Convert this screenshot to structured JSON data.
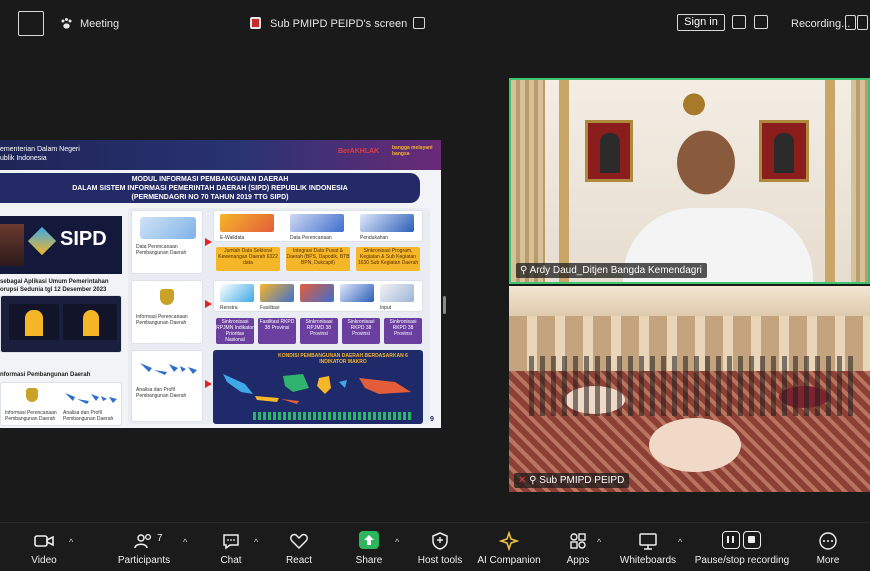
{
  "topbar": {
    "meeting_label": "Meeting",
    "screen_label": "Sub PMIPD PEIPD's screen",
    "signin_label": "Sign in",
    "recording_label": "Recording..."
  },
  "slide": {
    "org_line1": "ementerian Dalam Negeri",
    "org_line2": "ublik Indonesia",
    "logo1": "BerAKHLAK",
    "logo2": "bangga melayani bangsa",
    "title_line1": "MODUL INFORMASI PEMBANGUNAN DAERAH",
    "title_line2": "DALAM SISTEM INFORMASI PEMERINTAH DAERAH (SIPD) REPUBLIK INDONESIA",
    "title_line3": "(PERMENDAGRI NO 70 TAHUN 2019 TTG SIPD)",
    "sipd_text": "SIPD",
    "award_text": "sebagai Aplikasi Umum Pemerintahan",
    "award_text2": "orupsi Sedunia tgl 12 Desember 2023",
    "left_section_title": "nformasi Pembangunan Daerah",
    "left_cap1": "Informasi Perencanaan\nPembangunan Daerah",
    "left_cap2": "Analisa dan Profil Pembangunan Daerah",
    "row1_label": "Data Perencanaan Pembangunan Daerah",
    "row1_items": [
      "E-Walidata",
      "Data Perencanaan",
      "Pendukahan"
    ],
    "row1_boxes": [
      "Jumlah Data Sektoral Kewenangan Daerah 6322 data",
      "Integrasi Data Pusat & Daerah (BPS, Dapodik, BTB BPN, Dukcapil)",
      "Sinkronisasi Program, Kegiatan & Sub Kegiatan 1630 Sub Kegiatan Daerah"
    ],
    "row2_label": "Informasi Perencanaan Pembangunan Daerah",
    "row2_items": [
      "Renstra",
      "Fasilitasi",
      "",
      "",
      "Input"
    ],
    "row2_boxes": [
      "Sinkronisasi RPJMN Indikator Prioritas Nasional",
      "Fasilitasi RKPD 38 Provinsi",
      "Sinkronisasi RPJMD 38 Provinsi",
      "Sinkronisasi RKPD 38 Provinsi",
      "Sinkronisasi RKPD 38 Provinsi"
    ],
    "row3_label": "Analisa dan Profil Pembangunan Daerah",
    "map_title": "KONDISI PEMBANGUNAN DAERAH BERDASARKAN 6 INDIKATOR MAKRO",
    "page_number": "9"
  },
  "videos": [
    {
      "name": "Ardy Daud_Ditjen Bangda Kemendagri"
    },
    {
      "name": "Sub PMIPD PEIPD"
    }
  ],
  "toolbar": {
    "video": "Video",
    "participants": "Participants",
    "participants_count": "7",
    "chat": "Chat",
    "react": "React",
    "share": "Share",
    "host_tools": "Host tools",
    "ai_companion": "AI Companion",
    "apps": "Apps",
    "whiteboards": "Whiteboards",
    "pause_recording": "Pause/stop recording",
    "more": "More"
  },
  "colors": {
    "active_speaker_border": "#3ec46d",
    "share_green": "#2db55d",
    "accent": "#f5b628"
  }
}
